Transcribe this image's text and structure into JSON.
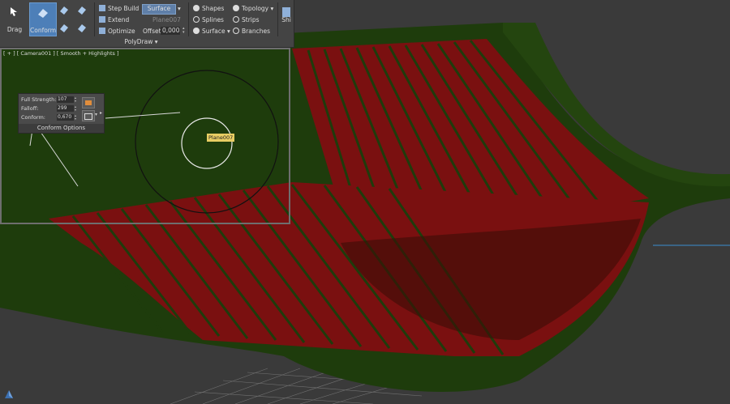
{
  "ribbon": {
    "drag_label": "Drag",
    "conform_label": "Conform",
    "step_build_label": "Step Build",
    "extend_label": "Extend",
    "optimize_label": "Optimize",
    "surface_button_label": "Surface",
    "surface_object_name": "Plane007",
    "offset_label": "Offset:",
    "offset_value": "0,000",
    "shapes_label": "Shapes",
    "splines_label": "Splines",
    "surface_dropdown_label": "Surface",
    "topology_label": "Topology",
    "strips_label": "Strips",
    "branches_label": "Branches",
    "shift_label": "Shi",
    "panel_title": "PolyDraw"
  },
  "viewport": {
    "label": "[ + ] [ Camera001 ] [ Smooth + Highlights ]",
    "tooltip": "Plane007"
  },
  "conform_options": {
    "full_strength_label": "Full Strength:",
    "full_strength_value": "107",
    "falloff_label": "Falloff:",
    "falloff_value": "299",
    "conform_label": "Conform:",
    "conform_value": "0,670",
    "title": "Conform Options"
  },
  "colors": {
    "background": "#3a3a3a",
    "green_surface": "#1e3c0c",
    "red_strips": "#7a1010",
    "ribbon": "#444444",
    "active_button": "#4d7fb8",
    "tooltip": "#e8cd63"
  },
  "icons": [
    "drag-icon",
    "conform-icon",
    "step-build-icon",
    "extend-icon",
    "optimize-icon",
    "shapes-icon",
    "splines-icon",
    "surface-icon",
    "topology-icon",
    "strips-icon",
    "branches-icon",
    "pin-stack-icon",
    "view-gizmo-icon"
  ]
}
